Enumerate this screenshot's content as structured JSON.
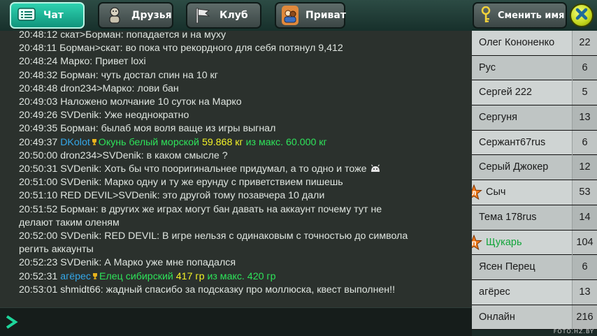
{
  "tabs": [
    {
      "label": "Чат",
      "icon": "chat-icon",
      "active": true
    },
    {
      "label": "Друзья",
      "icon": "friends-icon",
      "active": false
    },
    {
      "label": "Клуб",
      "icon": "club-flag-icon",
      "active": false
    },
    {
      "label": "Приват",
      "icon": "private-icon",
      "active": false
    }
  ],
  "change_name_label": "Сменить имя",
  "close_icon": "close-icon",
  "chat": {
    "lines": [
      {
        "time": "20:48:12",
        "text": "скат>Борман: попадается и на муху"
      },
      {
        "time": "20:48:11",
        "text": "Борман>скат: во пока что рекордного для себя потянул 9,412"
      },
      {
        "time": "20:48:24",
        "text": "Марко: Привет loxi"
      },
      {
        "time": "20:48:32",
        "text": "Борман: чуть достал спин на 10 кг"
      },
      {
        "time": "20:48:48",
        "text": "dron234>Марко: лови бан"
      },
      {
        "time": "20:49:03",
        "text": "Наложено молчание 10 суток на Марко"
      },
      {
        "time": "20:49:26",
        "text": "SVDenik: Уже неоднократно"
      },
      {
        "time": "20:49:35",
        "text": "Борман: былаб моя воля ваще из игры выгнал"
      },
      {
        "time": "20:49:37",
        "type": "catch",
        "user": "DKolot",
        "fish": "Окунь белый морской",
        "weight": "59.868 кг",
        "max": "из макс. 60.000 кг"
      },
      {
        "time": "20:50:00",
        "text": "dron234>SVDenik: в каком смысле ?"
      },
      {
        "time": "20:50:31",
        "text": "SVDenik: Хоть бы что пооригинальнее придумал, а то одно и тоже",
        "emoji": true
      },
      {
        "time": "20:51:00",
        "text": "SVDenik: Марко одну и ту же ерунду с приветствием пишешь"
      },
      {
        "time": "20:51:10",
        "text": "RED DEVIL>SVDenik: это другой тому позавчера 10 дали"
      },
      {
        "time": "20:51:52",
        "text": "Борман: в других же играх могут бан давать на аккаунт почему тут не"
      },
      {
        "time": "",
        "text": "делают таким оленям"
      },
      {
        "time": "20:52:00",
        "text": "SVDenik: RED DEVIL: В игре нельзя с одинаковым с точностью до символа"
      },
      {
        "time": "",
        "text": "регить аккаунты"
      },
      {
        "time": "20:52:23",
        "text": "SVDenik: А Марко уже мне попадался"
      },
      {
        "time": "20:52:31",
        "type": "catch",
        "user": "агёрес",
        "fish": "Елец сибирский",
        "weight": "417 гр",
        "max": "из макс. 420 гр"
      },
      {
        "time": "20:53:01",
        "text": "shmidt66: жадный спасибо за подсказку про моллюска, квест выполнен!!"
      }
    ],
    "input_value": ""
  },
  "players": [
    {
      "name": "Олег Кононенко",
      "level": "22"
    },
    {
      "name": "Рус",
      "level": "6"
    },
    {
      "name": "Сергей 222",
      "level": "5"
    },
    {
      "name": "Сергуня",
      "level": "13"
    },
    {
      "name": "Сержант67rus",
      "level": "6"
    },
    {
      "name": "Серый Джокер",
      "level": "12"
    },
    {
      "name": "Сыч",
      "level": "53",
      "badge": "Л"
    },
    {
      "name": "Тема 178rus",
      "level": "14"
    },
    {
      "name": "Щукарь",
      "level": "104",
      "badge": "П",
      "special": true
    },
    {
      "name": "Ясен Перец",
      "level": "6"
    },
    {
      "name": "агёрес",
      "level": "13"
    },
    {
      "name": "Онлайн",
      "level": "216"
    }
  ],
  "colors": {
    "active_tab": "#1fb896",
    "catch_user": "#34a7e8",
    "catch_fish": "#2ee35a",
    "catch_weight": "#f3f227",
    "special_player": "#12a53a"
  },
  "watermark": "FOTO.HZ.BY"
}
